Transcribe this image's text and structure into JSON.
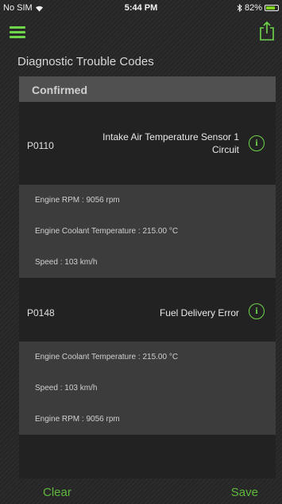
{
  "status_bar": {
    "carrier": "No SIM",
    "time": "5:44 PM",
    "battery_percent": "82%",
    "battery_level": 0.82
  },
  "nav": {
    "menu_icon": "hamburger-menu-icon",
    "share_icon": "share-icon",
    "accent_color": "#6fd54a"
  },
  "page": {
    "title": "Diagnostic Trouble Codes",
    "section_header": "Confirmed"
  },
  "codes": [
    {
      "id": "P0110",
      "description": "Intake Air Temperature Sensor 1 Circuit",
      "details": [
        "Engine RPM : 9056 rpm",
        "Engine Coolant Temperature : 215.00 °C",
        "Speed : 103 km/h"
      ]
    },
    {
      "id": "P0148",
      "description": "Fuel Delivery Error",
      "details": [
        "Engine Coolant Temperature : 215.00 °C",
        "Speed : 103 km/h",
        "Engine RPM : 9056 rpm"
      ]
    }
  ],
  "actions": {
    "clear_label": "Clear",
    "save_label": "Save"
  }
}
